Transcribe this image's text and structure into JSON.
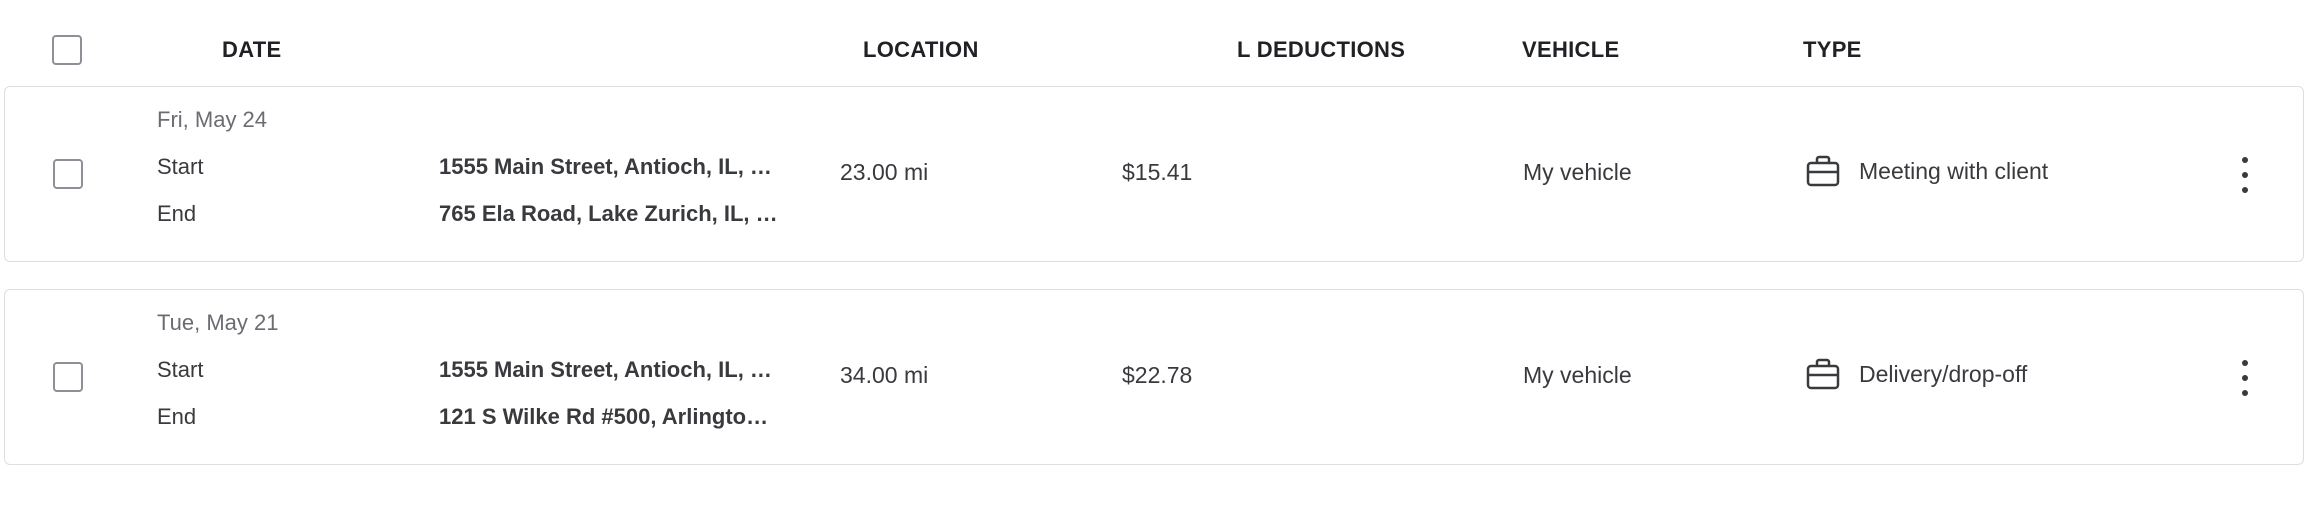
{
  "header": {
    "date": "DATE",
    "location": "LOCATION",
    "deductions": "L DEDUCTIONS",
    "vehicle": "VEHICLE",
    "type": "TYPE"
  },
  "rows": [
    {
      "date": "Fri, May 24",
      "start_label": "Start",
      "end_label": "End",
      "start_address": "1555 Main Street, Antioch, IL, …",
      "end_address": "765 Ela Road, Lake Zurich, IL, …",
      "distance": "23.00 mi",
      "deduction": "$15.41",
      "vehicle": "My vehicle",
      "type": "Meeting with client",
      "type_icon": "briefcase-icon"
    },
    {
      "date": "Tue, May 21",
      "start_label": "Start",
      "end_label": "End",
      "start_address": "1555 Main Street, Antioch, IL, …",
      "end_address": "121 S Wilke Rd #500, Arlingto…",
      "distance": "34.00 mi",
      "deduction": "$22.78",
      "vehicle": "My vehicle",
      "type": "Delivery/drop-off",
      "type_icon": "briefcase-icon"
    }
  ]
}
